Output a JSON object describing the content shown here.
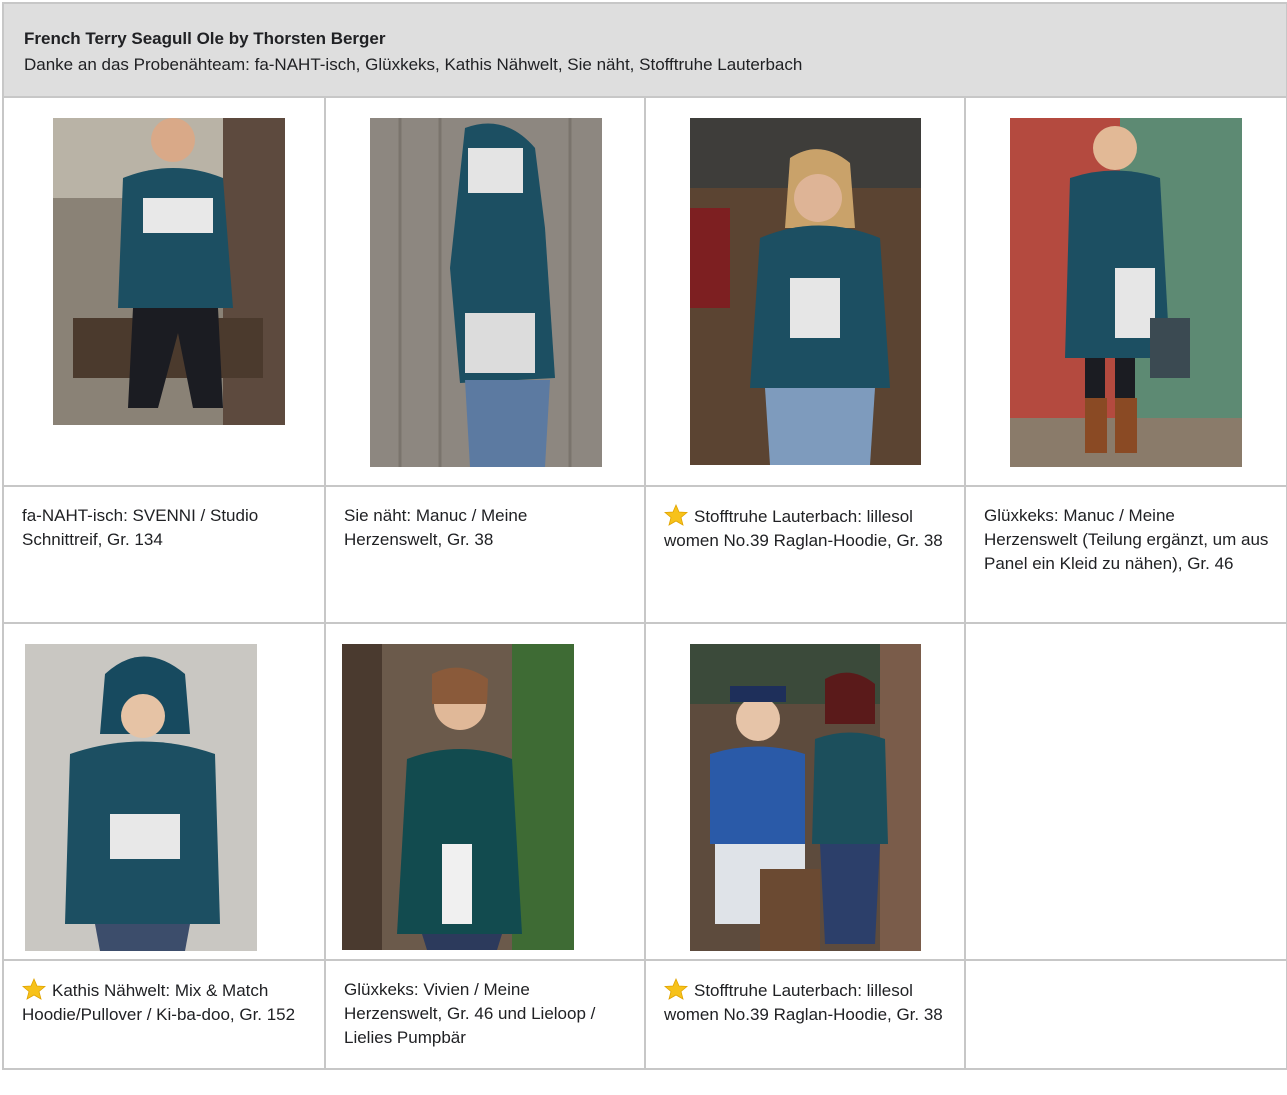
{
  "header": {
    "title": "French Terry Seagull Ole by Thorsten Berger",
    "subtitle": "Danke an das Probenähteam: fa-NAHT-isch, Glüxkeks, Kathis Nähwelt, Sie näht, Stofftruhe Lauterbach"
  },
  "colors": {
    "header_bg": "#dedede",
    "grid_line": "#c7c7c7",
    "star": "#f7c21a",
    "garment": "#1c4f62"
  },
  "row1": [
    {
      "caption": "fa-NAHT-isch: SVENNI / Studio Schnittreif, Gr. 134",
      "starred": false,
      "photo": "boy-sweatshirt-photo"
    },
    {
      "caption": "Sie näht: Manuc / Meine Herzenswelt, Gr. 38",
      "starred": false,
      "photo": "hoodie-back-photo"
    },
    {
      "caption": "Stofftruhe Lauterbach: lillesol women No.39 Raglan-Hoodie, Gr. 38",
      "starred": true,
      "photo": "woman-hoodie-photo"
    },
    {
      "caption": "Glüxkeks: Manuc / Meine Herzenswelt (Teilung ergänzt, um aus Panel ein Kleid zu nähen), Gr. 46",
      "starred": false,
      "photo": "woman-dress-photo"
    }
  ],
  "row2": [
    {
      "caption": "Kathis Nähwelt: Mix & Match Hoodie/Pullover / Ki-ba-doo, Gr. 152",
      "starred": true,
      "photo": "boy-hoodie-photo"
    },
    {
      "caption": "Glüxkeks: Vivien / Meine Herzenswelt, Gr. 46 und Lieloop / Lielies Pumpbär",
      "starred": false,
      "photo": "woman-seagull-photo"
    },
    {
      "caption": "Stofftruhe Lauterbach: lillesol women No.39 Raglan-Hoodie, Gr. 38",
      "starred": true,
      "photo": "woman-sailor-statue-photo"
    },
    {
      "caption": "",
      "starred": false,
      "photo": ""
    }
  ]
}
